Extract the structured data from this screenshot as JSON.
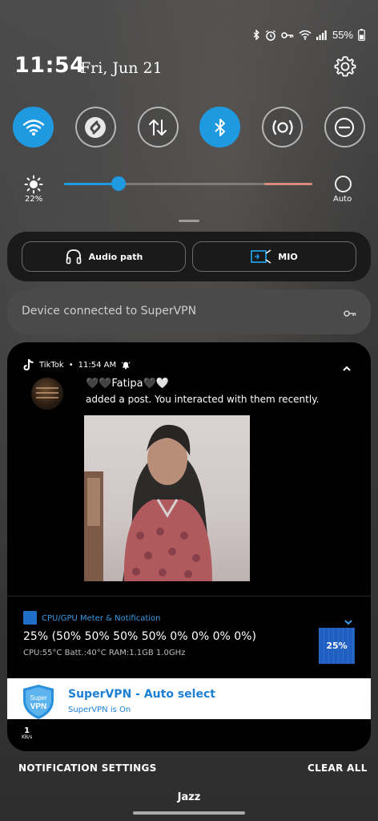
{
  "status_bar": {
    "icons": [
      "bluetooth-icon",
      "alarm-icon",
      "vpn-key-icon",
      "wifi-icon",
      "signal-icon",
      "battery-icon"
    ],
    "battery": "55%"
  },
  "header": {
    "time": "11:54",
    "date": "Fri, Jun 21"
  },
  "quick_toggles": [
    {
      "name": "wifi",
      "icon": "wifi-icon",
      "on": true
    },
    {
      "name": "shazam",
      "icon": "shazam-icon",
      "on": false
    },
    {
      "name": "mobile-data",
      "icon": "data-arrows-icon",
      "on": false
    },
    {
      "name": "bluetooth",
      "icon": "bluetooth-icon",
      "on": true
    },
    {
      "name": "sound",
      "icon": "sound-icon",
      "on": false
    },
    {
      "name": "do-not-disturb",
      "icon": "minus-circle-icon",
      "on": false
    }
  ],
  "brightness": {
    "percent_label": "22%",
    "level": 0.22,
    "auto_label": "Auto"
  },
  "media": {
    "audio_path": "Audio path",
    "device": "MIO"
  },
  "vpn_banner": {
    "text": "Device connected to SuperVPN"
  },
  "notifications": {
    "tiktok": {
      "app": "TikTok",
      "time": "11:54 AM",
      "sender": "🖤🖤Fatipa🖤🤍",
      "message": "added a post. You interacted with them recently."
    },
    "cpu": {
      "app": "CPU/GPU Meter & Notification",
      "main": "25% (50% 50% 50% 50% 0% 0% 0% 0%)",
      "sub": "CPU:55°C Batt.:40°C RAM:1.1GB 1.0GHz",
      "graph_label": "25%"
    },
    "supervpn": {
      "title": "SuperVPN - Auto select",
      "subtitle": "SuperVPN is On",
      "logo_top": "Super",
      "logo_bottom": "VPN",
      "speed_value": "1",
      "speed_unit": "KB/s"
    }
  },
  "footer": {
    "settings": "NOTIFICATION SETTINGS",
    "clear": "CLEAR ALL",
    "carrier": "Jazz"
  },
  "colors": {
    "accent": "#1f9ae0",
    "vpn_blue": "#1b7fd6",
    "cpu_blue": "#3c9be6"
  }
}
